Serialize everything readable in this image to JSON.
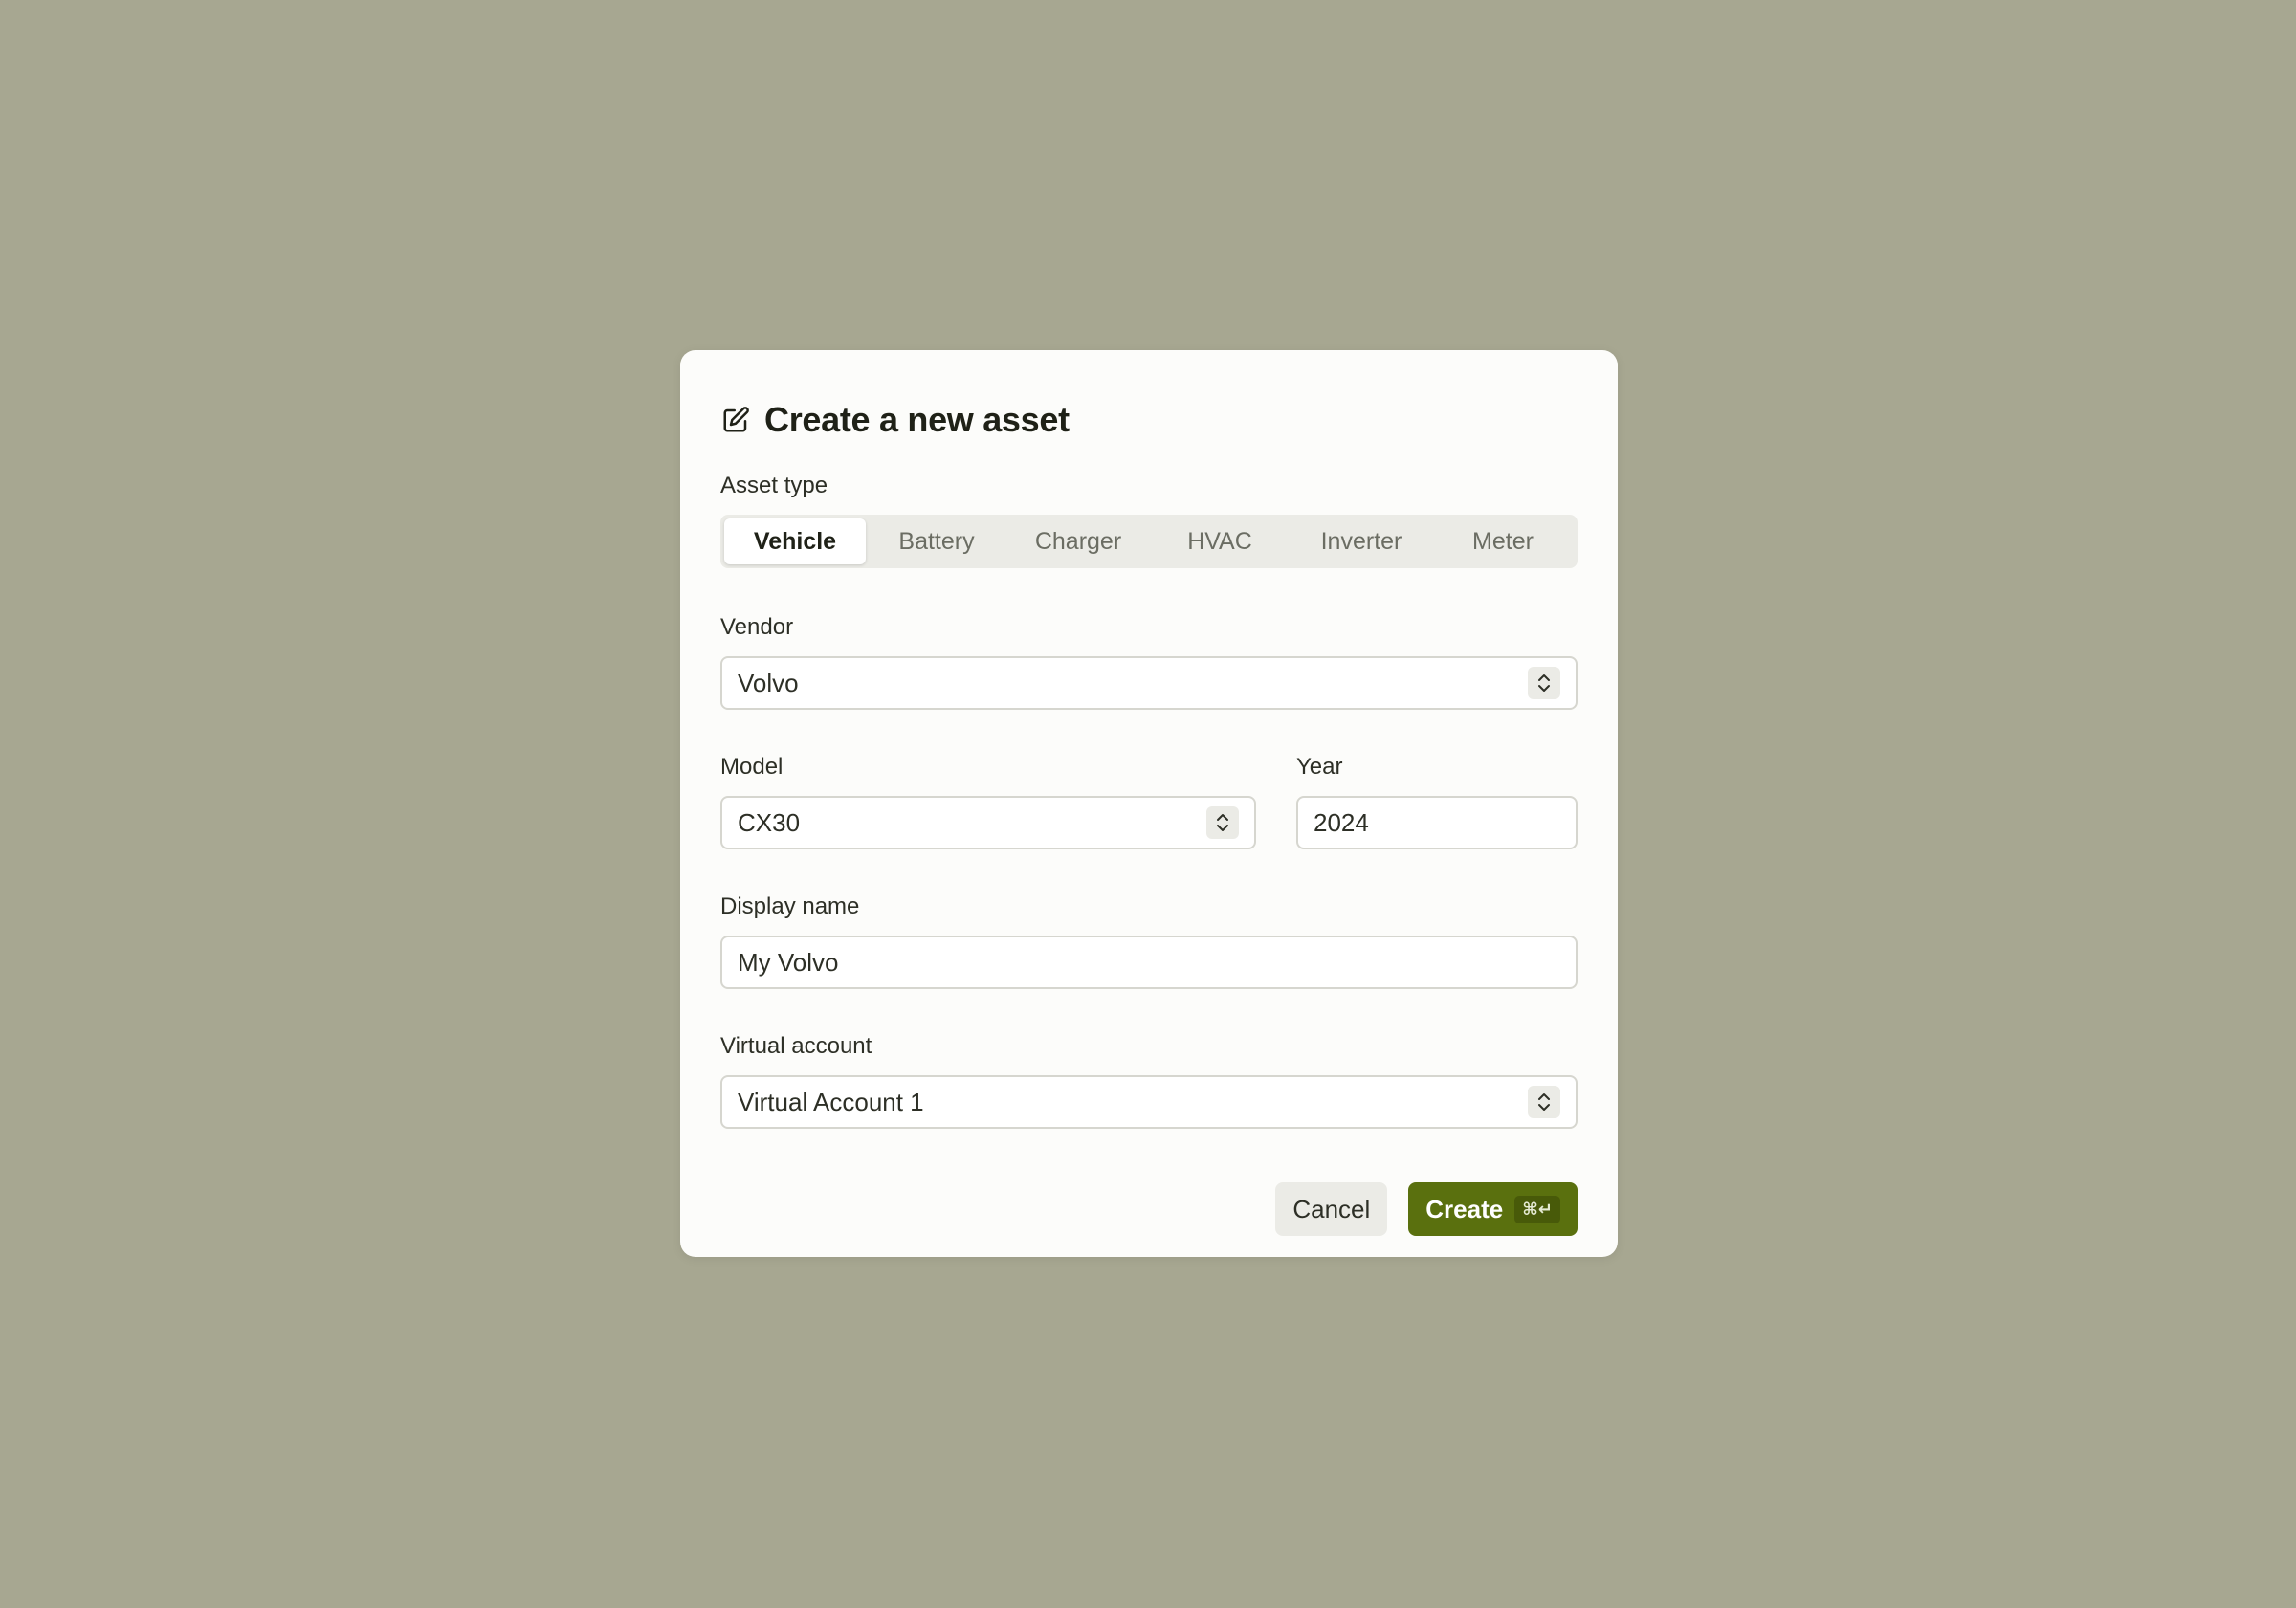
{
  "dialog": {
    "title": "Create a new asset",
    "icon": "edit-icon"
  },
  "asset_type": {
    "label": "Asset type",
    "options": [
      "Vehicle",
      "Battery",
      "Charger",
      "HVAC",
      "Inverter",
      "Meter"
    ],
    "selected": "Vehicle"
  },
  "vendor": {
    "label": "Vendor",
    "value": "Volvo"
  },
  "model": {
    "label": "Model",
    "value": "CX30"
  },
  "year": {
    "label": "Year",
    "value": "2024"
  },
  "display_name": {
    "label": "Display name",
    "value": "My Volvo"
  },
  "virtual_account": {
    "label": "Virtual account",
    "value": "Virtual Account 1"
  },
  "actions": {
    "cancel_label": "Cancel",
    "create_label": "Create",
    "create_shortcut": "⌘↵"
  },
  "colors": {
    "backdrop": "#a7a791",
    "dialog": "#fcfcfa",
    "accent": "#5a700e"
  }
}
